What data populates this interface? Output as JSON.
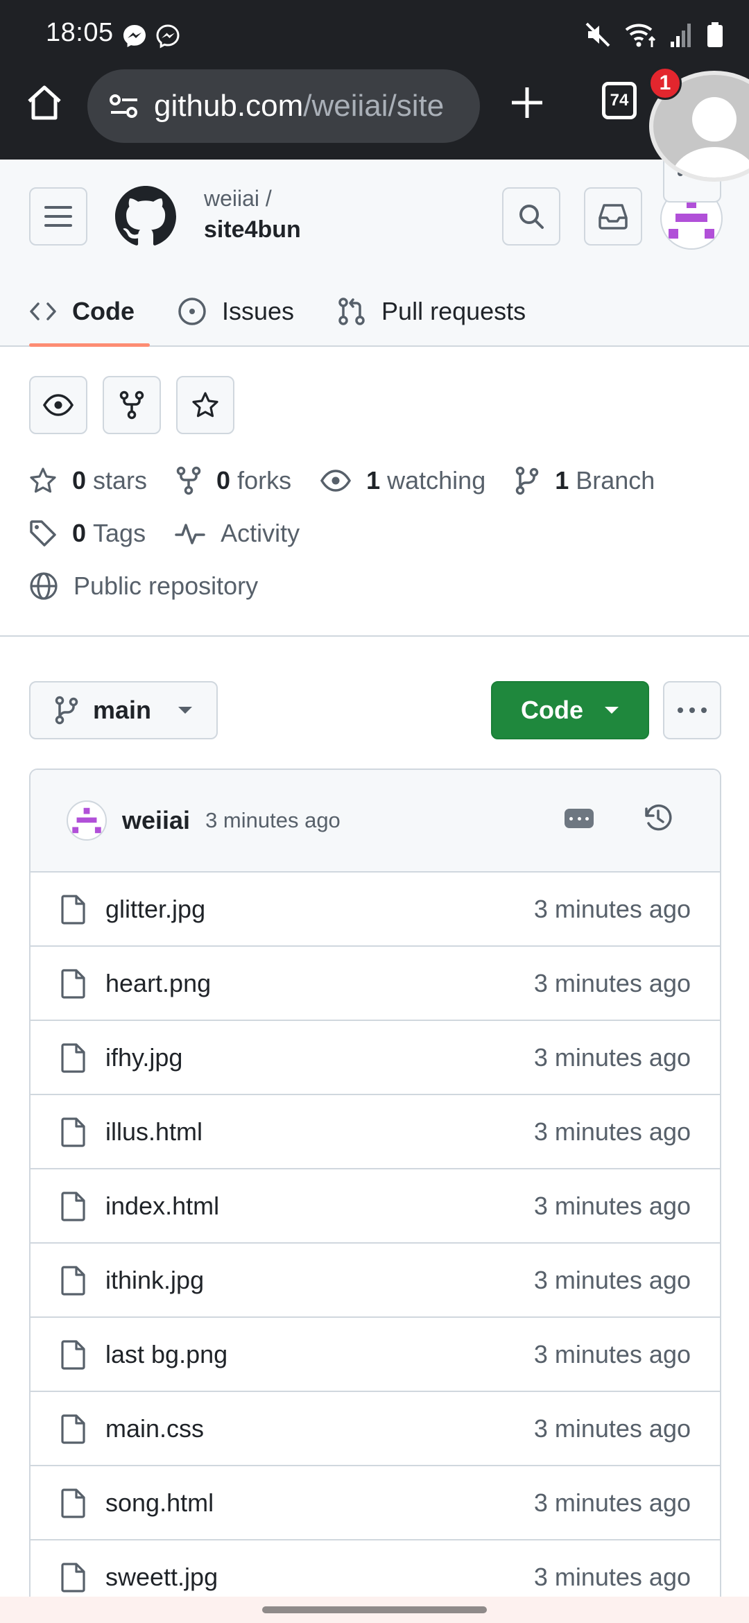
{
  "status_bar": {
    "time": "18:05",
    "icons": [
      "messenger-icon",
      "messenger-icon",
      "mute-icon",
      "wifi-icon",
      "signal-icon",
      "battery-icon"
    ]
  },
  "browser": {
    "url_host": "github.com",
    "url_path": "/weiiai/site",
    "tab_count": "74",
    "notification_count": "1"
  },
  "repo": {
    "owner": "weiiai /",
    "name": "site4bun",
    "tabs": [
      {
        "label": "Code",
        "icon": "code-icon",
        "active": true
      },
      {
        "label": "Issues",
        "icon": "issue-icon",
        "active": false
      },
      {
        "label": "Pull requests",
        "icon": "pull-request-icon",
        "active": false
      }
    ],
    "stats": {
      "stars_count": "0",
      "stars_label": "stars",
      "forks_count": "0",
      "forks_label": "forks",
      "watching_count": "1",
      "watching_label": "watching",
      "branch_count": "1",
      "branch_label": "Branch",
      "tags_count": "0",
      "tags_label": "Tags",
      "activity_label": "Activity",
      "visibility_label": "Public repository"
    },
    "branch": "main",
    "code_button": "Code"
  },
  "latest_commit": {
    "author": "weiiai",
    "time": "3 minutes ago"
  },
  "files": [
    {
      "name": "glitter.jpg",
      "time": "3 minutes ago"
    },
    {
      "name": "heart.png",
      "time": "3 minutes ago"
    },
    {
      "name": "ifhy.jpg",
      "time": "3 minutes ago"
    },
    {
      "name": "illus.html",
      "time": "3 minutes ago"
    },
    {
      "name": "index.html",
      "time": "3 minutes ago"
    },
    {
      "name": "ithink.jpg",
      "time": "3 minutes ago"
    },
    {
      "name": "last bg.png",
      "time": "3 minutes ago"
    },
    {
      "name": "main.css",
      "time": "3 minutes ago"
    },
    {
      "name": "song.html",
      "time": "3 minutes ago"
    },
    {
      "name": "sweett.jpg",
      "time": "3 minutes ago"
    }
  ],
  "colors": {
    "accent_tab_underline": "#fd8c73",
    "code_button": "#1f883d",
    "avatar_identicon": "#b150d8",
    "badge": "#e3262e"
  }
}
